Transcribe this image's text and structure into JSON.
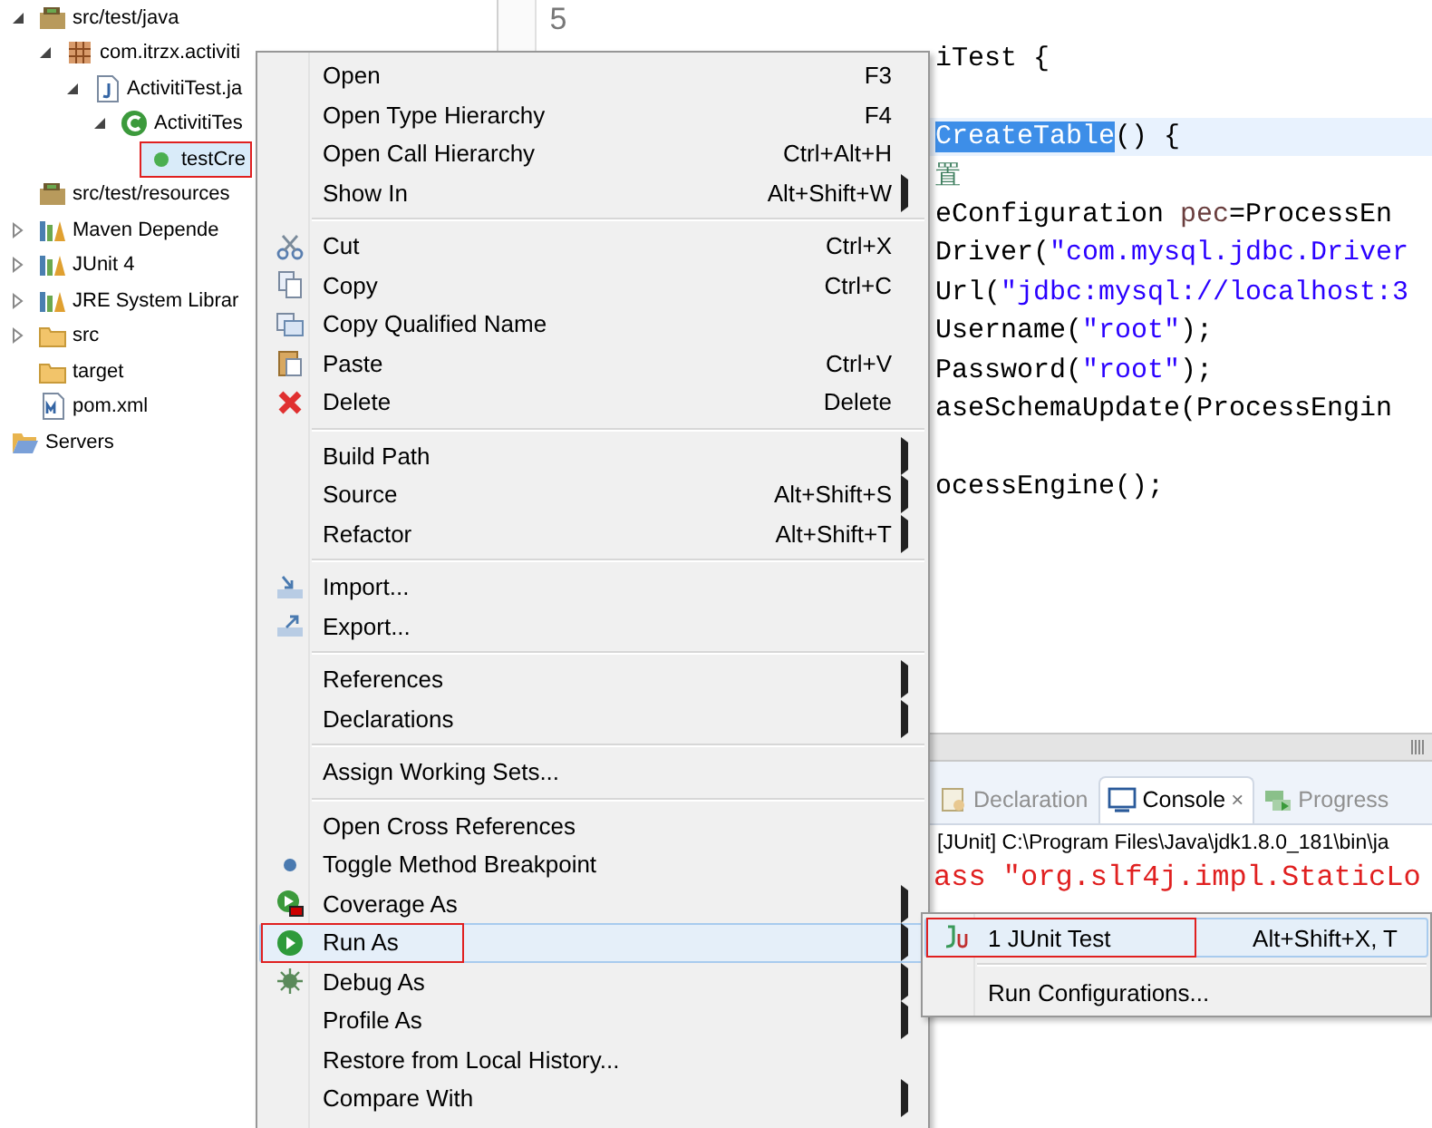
{
  "explorer": {
    "project_children": [
      {
        "label": "src/test/java",
        "kind": "source-folder",
        "expanded": true,
        "selected": false,
        "marked": false,
        "children": [
          {
            "label": "com.itrzx.activiti",
            "kind": "package",
            "expanded": true,
            "selected": false,
            "marked": false,
            "children": [
              {
                "label": "ActivitiTest.ja",
                "kind": "java-file",
                "expanded": true,
                "selected": false,
                "marked": false,
                "children": [
                  {
                    "label": "ActivitiTes",
                    "kind": "class",
                    "expanded": true,
                    "selected": false,
                    "marked": false,
                    "children": [
                      {
                        "label": "testCre",
                        "kind": "method",
                        "selected": true,
                        "marked": true
                      }
                    ]
                  }
                ]
              }
            ]
          }
        ]
      },
      {
        "label": "src/test/resources",
        "kind": "source-folder",
        "selected": false,
        "marked": false
      },
      {
        "label": "Maven Depende",
        "kind": "library",
        "expanded": false,
        "selected": false,
        "marked": false
      },
      {
        "label": "JUnit 4",
        "kind": "library",
        "expanded": false,
        "selected": false,
        "marked": false
      },
      {
        "label": "JRE System Librar",
        "kind": "library",
        "expanded": false,
        "selected": false,
        "marked": false
      },
      {
        "label": "src",
        "kind": "folder",
        "expanded": false,
        "selected": false,
        "marked": false
      },
      {
        "label": "target",
        "kind": "folder",
        "selected": false,
        "marked": false
      },
      {
        "label": "pom.xml",
        "kind": "xml-file",
        "selected": false,
        "marked": false
      }
    ],
    "top_level": [
      {
        "label": "Servers",
        "kind": "open-folder",
        "selected": false,
        "marked": false
      }
    ]
  },
  "editor": {
    "rows": [
      {
        "line_number": "5",
        "current": false,
        "segments": []
      },
      {
        "current": false,
        "segments": [
          {
            "text": "iTest {",
            "kind": "plain"
          }
        ]
      },
      {
        "current": false,
        "segments": []
      },
      {
        "current": true,
        "segments": [
          {
            "text": "CreateTable",
            "kind": "selected"
          },
          {
            "text": "() {",
            "kind": "plain"
          }
        ]
      },
      {
        "current": false,
        "segments": [
          {
            "text": "置",
            "kind": "comment"
          }
        ]
      },
      {
        "current": false,
        "segments": [
          {
            "text": "eConfiguration ",
            "kind": "plain"
          },
          {
            "text": "pec",
            "kind": "variable"
          },
          {
            "text": "=ProcessEn",
            "kind": "plain"
          }
        ]
      },
      {
        "current": false,
        "segments": [
          {
            "text": "Driver(",
            "kind": "plain"
          },
          {
            "text": "\"com.mysql.jdbc.Driver",
            "kind": "string"
          }
        ]
      },
      {
        "current": false,
        "segments": [
          {
            "text": "Url(",
            "kind": "plain"
          },
          {
            "text": "\"jdbc:mysql://localhost:3",
            "kind": "string"
          }
        ]
      },
      {
        "current": false,
        "segments": [
          {
            "text": "Username(",
            "kind": "plain"
          },
          {
            "text": "\"root\"",
            "kind": "string"
          },
          {
            "text": ");",
            "kind": "plain"
          }
        ]
      },
      {
        "current": false,
        "segments": [
          {
            "text": "Password(",
            "kind": "plain"
          },
          {
            "text": "\"root\"",
            "kind": "string"
          },
          {
            "text": ");",
            "kind": "plain"
          }
        ]
      },
      {
        "current": false,
        "segments": [
          {
            "text": "aseSchemaUpdate(ProcessEngin",
            "kind": "plain"
          }
        ]
      },
      {
        "current": false,
        "segments": []
      },
      {
        "current": false,
        "segments": [
          {
            "text": "ocessEngine();",
            "kind": "plain"
          }
        ]
      }
    ]
  },
  "console": {
    "tabs": [
      {
        "label": "Declaration",
        "kind": "declaration",
        "selected": false
      },
      {
        "label": "Console",
        "kind": "console",
        "selected": true,
        "close": "×"
      },
      {
        "label": "Progress",
        "kind": "progress",
        "selected": false
      }
    ],
    "description": "[JUnit] C:\\Program Files\\Java\\jdk1.8.0_181\\bin\\ja",
    "lines": [
      {
        "text": "ass \"org.slf4j.impl.StaticLo",
        "kind": "error"
      }
    ]
  },
  "context_menu": {
    "items": [
      {
        "kind": "plain",
        "label": "Open",
        "shortcut": "F3",
        "submenu": false,
        "selected": false,
        "marked": false
      },
      {
        "kind": "plain",
        "label": "Open Type Hierarchy",
        "shortcut": "F4",
        "submenu": false,
        "selected": false,
        "marked": false
      },
      {
        "kind": "plain",
        "label": "Open Call Hierarchy",
        "shortcut": "Ctrl+Alt+H",
        "submenu": false,
        "selected": false,
        "marked": false
      },
      {
        "kind": "plain",
        "label": "Show In",
        "shortcut": "Alt+Shift+W",
        "submenu": true,
        "selected": false,
        "marked": false
      },
      {
        "kind": "separator"
      },
      {
        "kind": "cut",
        "label": "Cut",
        "shortcut": "Ctrl+X",
        "submenu": false,
        "selected": false,
        "marked": false
      },
      {
        "kind": "copy",
        "label": "Copy",
        "shortcut": "Ctrl+C",
        "submenu": false,
        "selected": false,
        "marked": false
      },
      {
        "kind": "copy-name",
        "label": "Copy Qualified Name",
        "submenu": false,
        "selected": false,
        "marked": false
      },
      {
        "kind": "paste",
        "label": "Paste",
        "shortcut": "Ctrl+V",
        "submenu": false,
        "selected": false,
        "marked": false
      },
      {
        "kind": "delete",
        "label": "Delete",
        "shortcut": "Delete",
        "submenu": false,
        "selected": false,
        "marked": false
      },
      {
        "kind": "separator"
      },
      {
        "kind": "plain",
        "label": "Build Path",
        "submenu": true,
        "selected": false,
        "marked": false
      },
      {
        "kind": "plain",
        "label": "Source",
        "shortcut": "Alt+Shift+S",
        "submenu": true,
        "selected": false,
        "marked": false
      },
      {
        "kind": "plain",
        "label": "Refactor",
        "shortcut": "Alt+Shift+T",
        "submenu": true,
        "selected": false,
        "marked": false
      },
      {
        "kind": "separator"
      },
      {
        "kind": "import",
        "label": "Import...",
        "submenu": false,
        "selected": false,
        "marked": false
      },
      {
        "kind": "export",
        "label": "Export...",
        "submenu": false,
        "selected": false,
        "marked": false
      },
      {
        "kind": "separator"
      },
      {
        "kind": "plain",
        "label": "References",
        "submenu": true,
        "selected": false,
        "marked": false
      },
      {
        "kind": "plain",
        "label": "Declarations",
        "submenu": true,
        "selected": false,
        "marked": false
      },
      {
        "kind": "separator"
      },
      {
        "kind": "plain",
        "label": "Assign Working Sets...",
        "submenu": false,
        "selected": false,
        "marked": false
      },
      {
        "kind": "separator"
      },
      {
        "kind": "plain",
        "label": "Open Cross References",
        "submenu": false,
        "selected": false,
        "marked": false
      },
      {
        "kind": "breakpoint",
        "label": "Toggle Method Breakpoint",
        "submenu": false,
        "selected": false,
        "marked": false
      },
      {
        "kind": "coverage",
        "label": "Coverage As",
        "submenu": true,
        "selected": false,
        "marked": false
      },
      {
        "kind": "run",
        "label": "Run As",
        "submenu": true,
        "selected": true,
        "marked": true
      },
      {
        "kind": "debug",
        "label": "Debug As",
        "submenu": true,
        "selected": false,
        "marked": false
      },
      {
        "kind": "plain",
        "label": "Profile As",
        "submenu": true,
        "selected": false,
        "marked": false
      },
      {
        "kind": "plain",
        "label": "Restore from Local History...",
        "submenu": false,
        "selected": false,
        "marked": false
      },
      {
        "kind": "plain",
        "label": "Compare With",
        "submenu": true,
        "selected": false,
        "marked": false
      }
    ]
  },
  "run_as_submenu": {
    "items": [
      {
        "kind": "junit",
        "label": "1 JUnit Test",
        "shortcut": "Alt+Shift+X, T",
        "submenu": false,
        "selected": true,
        "marked": true
      },
      {
        "kind": "separator"
      },
      {
        "kind": "plain",
        "label": "Run Configurations...",
        "submenu": false,
        "selected": false,
        "marked": false
      }
    ]
  }
}
